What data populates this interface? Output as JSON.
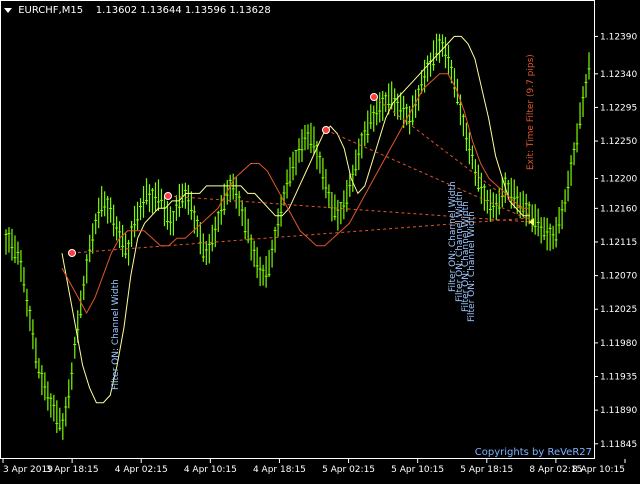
{
  "header": {
    "symbol": "EURCHF,M15",
    "ohlc": "1.13602 1.13644 1.13596 1.13628"
  },
  "copyright": "Copyrights by ReVeR27",
  "annotations": {
    "filter_on_1": "Filter ON: Channel Width",
    "filter_on_2": "Filter ON: Channel Width",
    "filter_on_3": "Filter ON: Channel Width",
    "filter_on_4": "Filter ON: Channel Width",
    "filter_on_5": "Filter ON: Channel Width",
    "exit_filter": "Exit: Time Filter (9.7 pips)"
  },
  "colors": {
    "background": "#000000",
    "candle": "#7CFC00",
    "upper_band": "#ffff99",
    "lower_band": "#e0552b",
    "dashed_line": "#e0552b",
    "annotation_blue": "#9ec8ff",
    "annotation_red": "#e0552b",
    "axis": "#ffffff"
  },
  "chart_data": {
    "type": "candlestick",
    "y_ticks": [
      "1.12390",
      "1.12340",
      "1.12295",
      "1.12250",
      "1.12200",
      "1.12160",
      "1.12115",
      "1.12070",
      "1.12025",
      "1.11980",
      "1.11935",
      "1.11890",
      "1.11845"
    ],
    "x_ticks": [
      "3 Apr 2019",
      "3 Apr 18:15",
      "4 Apr 02:15",
      "4 Apr 10:15",
      "4 Apr 18:15",
      "5 Apr 02:15",
      "5 Apr 10:15",
      "5 Apr 18:15",
      "8 Apr 02:15",
      "8 Apr 10:15"
    ],
    "ylim": [
      1.1183,
      1.1242
    ],
    "close_series": [
      1.1212,
      1.1211,
      1.121,
      1.1205,
      1.12,
      1.1195,
      1.1192,
      1.119,
      1.1188,
      1.1187,
      1.1192,
      1.1199,
      1.1205,
      1.121,
      1.1214,
      1.1217,
      1.1216,
      1.1214,
      1.1212,
      1.121,
      1.1214,
      1.1216,
      1.1218,
      1.1217,
      1.1218,
      1.1215,
      1.1214,
      1.1217,
      1.1218,
      1.1216,
      1.1213,
      1.121,
      1.1211,
      1.1214,
      1.1217,
      1.1219,
      1.1218,
      1.1215,
      1.1212,
      1.1209,
      1.1207,
      1.1208,
      1.1212,
      1.1216,
      1.122,
      1.1222,
      1.1224,
      1.1226,
      1.1225,
      1.1222,
      1.1219,
      1.1216,
      1.1215,
      1.1217,
      1.122,
      1.1223,
      1.1226,
      1.1228,
      1.1229,
      1.123,
      1.1231,
      1.123,
      1.1229,
      1.1228,
      1.123,
      1.1233,
      1.1235,
      1.1237,
      1.1238,
      1.1236,
      1.1233,
      1.1229,
      1.1225,
      1.1222,
      1.1219,
      1.1217,
      1.1216,
      1.1217,
      1.1219,
      1.1218,
      1.1217,
      1.1216,
      1.1215,
      1.1214,
      1.1213,
      1.1212,
      1.1213,
      1.1216,
      1.122,
      1.1225,
      1.123,
      1.1235
    ],
    "upper_band": [
      1.121,
      1.1205,
      1.12,
      1.1195,
      1.1192,
      1.119,
      1.119,
      1.1191,
      1.1195,
      1.12,
      1.1207,
      1.1212,
      1.1214,
      1.1215,
      1.1216,
      1.1216,
      1.1217,
      1.1217,
      1.1218,
      1.1218,
      1.1218,
      1.1219,
      1.1219,
      1.1219,
      1.1219,
      1.1219,
      1.1219,
      1.1218,
      1.1218,
      1.1217,
      1.1216,
      1.1215,
      1.1215,
      1.1216,
      1.1218,
      1.122,
      1.1222,
      1.1224,
      1.1226,
      1.1227,
      1.1226,
      1.1224,
      1.122,
      1.1218,
      1.1219,
      1.1222,
      1.1225,
      1.1228,
      1.123,
      1.1231,
      1.1232,
      1.1233,
      1.1234,
      1.1235,
      1.1236,
      1.1237,
      1.1238,
      1.1239,
      1.1239,
      1.1238,
      1.1236,
      1.1232,
      1.1228,
      1.1223,
      1.122,
      1.1217,
      1.1216,
      1.1215,
      1.1215
    ],
    "lower_band": [
      1.1208,
      1.1206,
      1.1204,
      1.1202,
      1.1204,
      1.1207,
      1.121,
      1.1212,
      1.1213,
      1.1213,
      1.1213,
      1.1212,
      1.1211,
      1.1211,
      1.1212,
      1.1212,
      1.1213,
      1.1214,
      1.1215,
      1.1216,
      1.1218,
      1.122,
      1.1221,
      1.1222,
      1.1222,
      1.1221,
      1.1219,
      1.1217,
      1.1215,
      1.1213,
      1.1212,
      1.1211,
      1.1211,
      1.1212,
      1.1213,
      1.1214,
      1.1216,
      1.1218,
      1.122,
      1.1222,
      1.1224,
      1.1226,
      1.1228,
      1.123,
      1.1232,
      1.1233,
      1.1234,
      1.1234,
      1.1232,
      1.1229,
      1.1225,
      1.1222,
      1.122,
      1.1219,
      1.1218,
      1.1217,
      1.1216,
      1.1216
    ]
  }
}
